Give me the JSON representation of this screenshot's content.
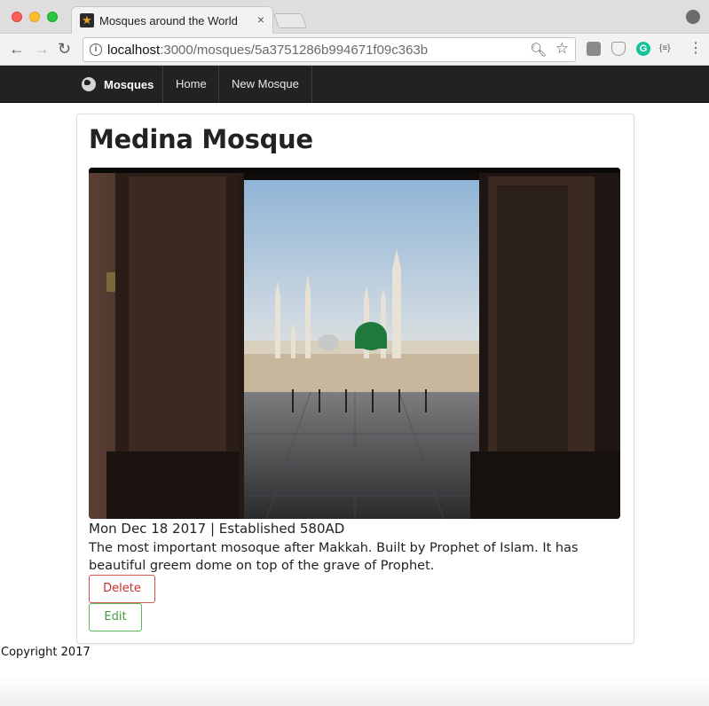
{
  "browser": {
    "tab_title": "Mosques around the World",
    "tab_close": "×",
    "url_host": "localhost",
    "url_path": ":3000/mosques/5a3751286b994671f09c363b",
    "nav_back": "←",
    "nav_forward": "→",
    "nav_reload": "↻",
    "menu": "⋮",
    "extension_grammarly": "G",
    "extension_json": "{≡}"
  },
  "navbar": {
    "brand": "Mosques",
    "links": [
      {
        "label": "Home"
      },
      {
        "label": "New Mosque"
      }
    ]
  },
  "mosque": {
    "title": "Medina Mosque",
    "meta": "Mon Dec 18 2017 | Established 580AD",
    "description": "The most important mosoque after Makkah. Built by Prophet of Islam. It has beautiful greem dome on top of the grave of Prophet.",
    "actions": {
      "delete_label": "Delete",
      "edit_label": "Edit"
    }
  },
  "footer": {
    "text": "Copyright 2017"
  },
  "icons": {
    "favicon": "star-icon",
    "brand": "globe-icon",
    "address_info": "info-icon",
    "zoom": "zoom-icon",
    "bookmark": "star-outline-icon"
  },
  "colors": {
    "navbar_bg": "#222222",
    "delete": "#d9534f",
    "edit": "#5cb85c",
    "dome": "#1d7a3a"
  }
}
